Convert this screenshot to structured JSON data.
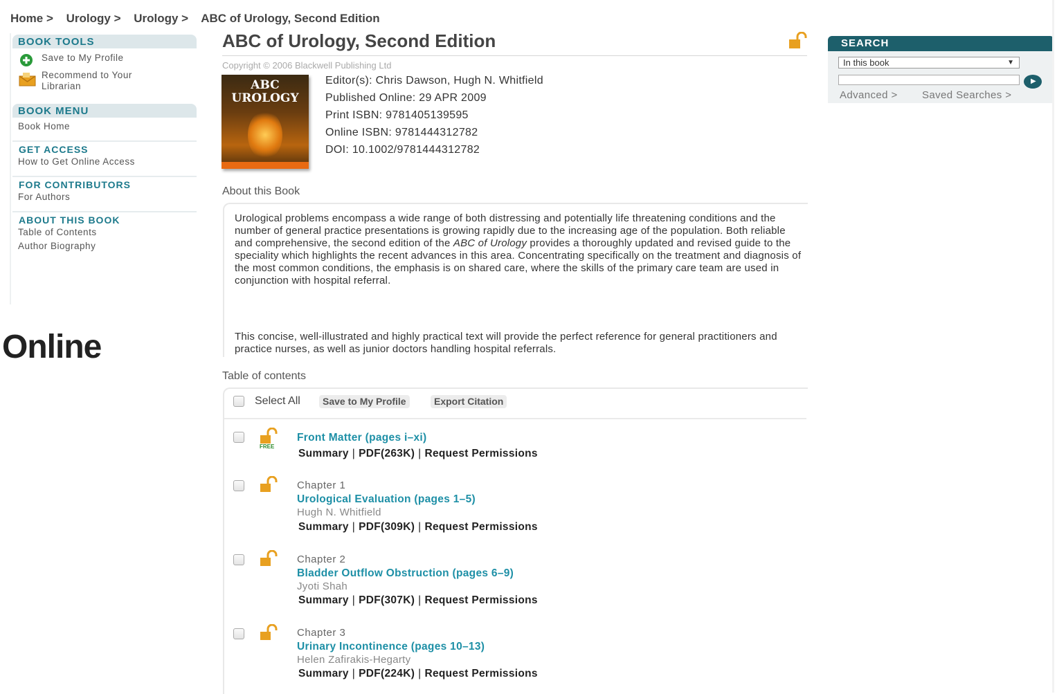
{
  "breadcrumb": {
    "items": [
      "Home >",
      "Urology >",
      "Urology >",
      "ABC of Urology, Second Edition"
    ]
  },
  "sidebar": {
    "book_tools": {
      "heading": "BOOK TOOLS",
      "save_label": "Save to My Profile",
      "recommend_label_1": "Recommend to Your",
      "recommend_label_2": "Librarian"
    },
    "book_menu": {
      "heading": "BOOK MENU",
      "home_label": "Book Home"
    },
    "get_access": {
      "heading": "GET ACCESS",
      "link": "How to Get Online Access"
    },
    "contributors": {
      "heading": "FOR CONTRIBUTORS",
      "link": "For Authors"
    },
    "about": {
      "heading": "ABOUT THIS BOOK",
      "toc_link": "Table of Contents",
      "bio_link": "Author Biography"
    }
  },
  "overlay": {
    "online_label": "Online"
  },
  "book": {
    "title": "ABC of Urology, Second Edition",
    "copyright": "Copyright © 2006 Blackwell Publishing Ltd",
    "cover_line1": "ABC",
    "cover_line2": "UROLOGY",
    "editors": "Editor(s): Chris Dawson, Hugh N. Whitfield",
    "published": "Published Online: 29 APR 2009",
    "print_isbn": "Print ISBN: 9781405139595",
    "online_isbn": "Online ISBN: 9781444312782",
    "doi": "DOI: 10.1002/9781444312782"
  },
  "about": {
    "heading": "About this Book",
    "p1_before": "Urological problems encompass a wide range of both distressing and potentially life threatening conditions and the number of general practice presentations is growing rapidly due to the increasing age of the population. Both reliable and comprehensive, the second edition of the ",
    "p1_italic": "ABC of Urology",
    "p1_after": " provides a thoroughly updated and revised guide to the speciality which highlights the recent advances in this area. Concentrating specifically on the treatment and diagnosis of the most common conditions, the emphasis is on shared care, where the skills of the primary care team are used in conjunction with hospital referral.",
    "p2": "This concise, well-illustrated and highly practical text will provide the perfect reference for general practitioners and practice nurses, as well as junior doctors handling hospital referrals."
  },
  "toc": {
    "heading": "Table of contents",
    "select_all": "Select All",
    "save_button": "Save to My Profile",
    "export_button": "Export Citation",
    "link_summary": "Summary",
    "link_separator": "|",
    "link_request": "Request Permissions",
    "free_badge": "FREE",
    "entries": [
      {
        "chapter": "",
        "title": "Front Matter (pages i–xi)",
        "author": "",
        "pdf": "PDF(263K)"
      },
      {
        "chapter": "Chapter 1",
        "title": "Urological Evaluation (pages 1–5)",
        "author": "Hugh N. Whitfield",
        "pdf": "PDF(309K)"
      },
      {
        "chapter": "Chapter 2",
        "title": "Bladder Outflow Obstruction (pages 6–9)",
        "author": "Jyoti Shah",
        "pdf": "PDF(307K)"
      },
      {
        "chapter": "Chapter 3",
        "title": "Urinary Incontinence (pages 10–13)",
        "author": "Helen Zafirakis-Hegarty",
        "pdf": "PDF(224K)"
      }
    ]
  },
  "search": {
    "heading": "SEARCH",
    "scope_selected": "In this book",
    "input_value": "",
    "advanced_link": "Advanced >",
    "saved_link": "Saved Searches >"
  },
  "colors": {
    "accent_teal": "#1d7a8c",
    "link_teal": "#1d8fa6",
    "search_header": "#1d5f6b",
    "lock_orange": "#e8a020"
  },
  "icons": {
    "save": "plus-circle-icon",
    "recommend": "envelope-icon",
    "access": "open-lock-icon",
    "search_go": "arrow-right-icon"
  }
}
